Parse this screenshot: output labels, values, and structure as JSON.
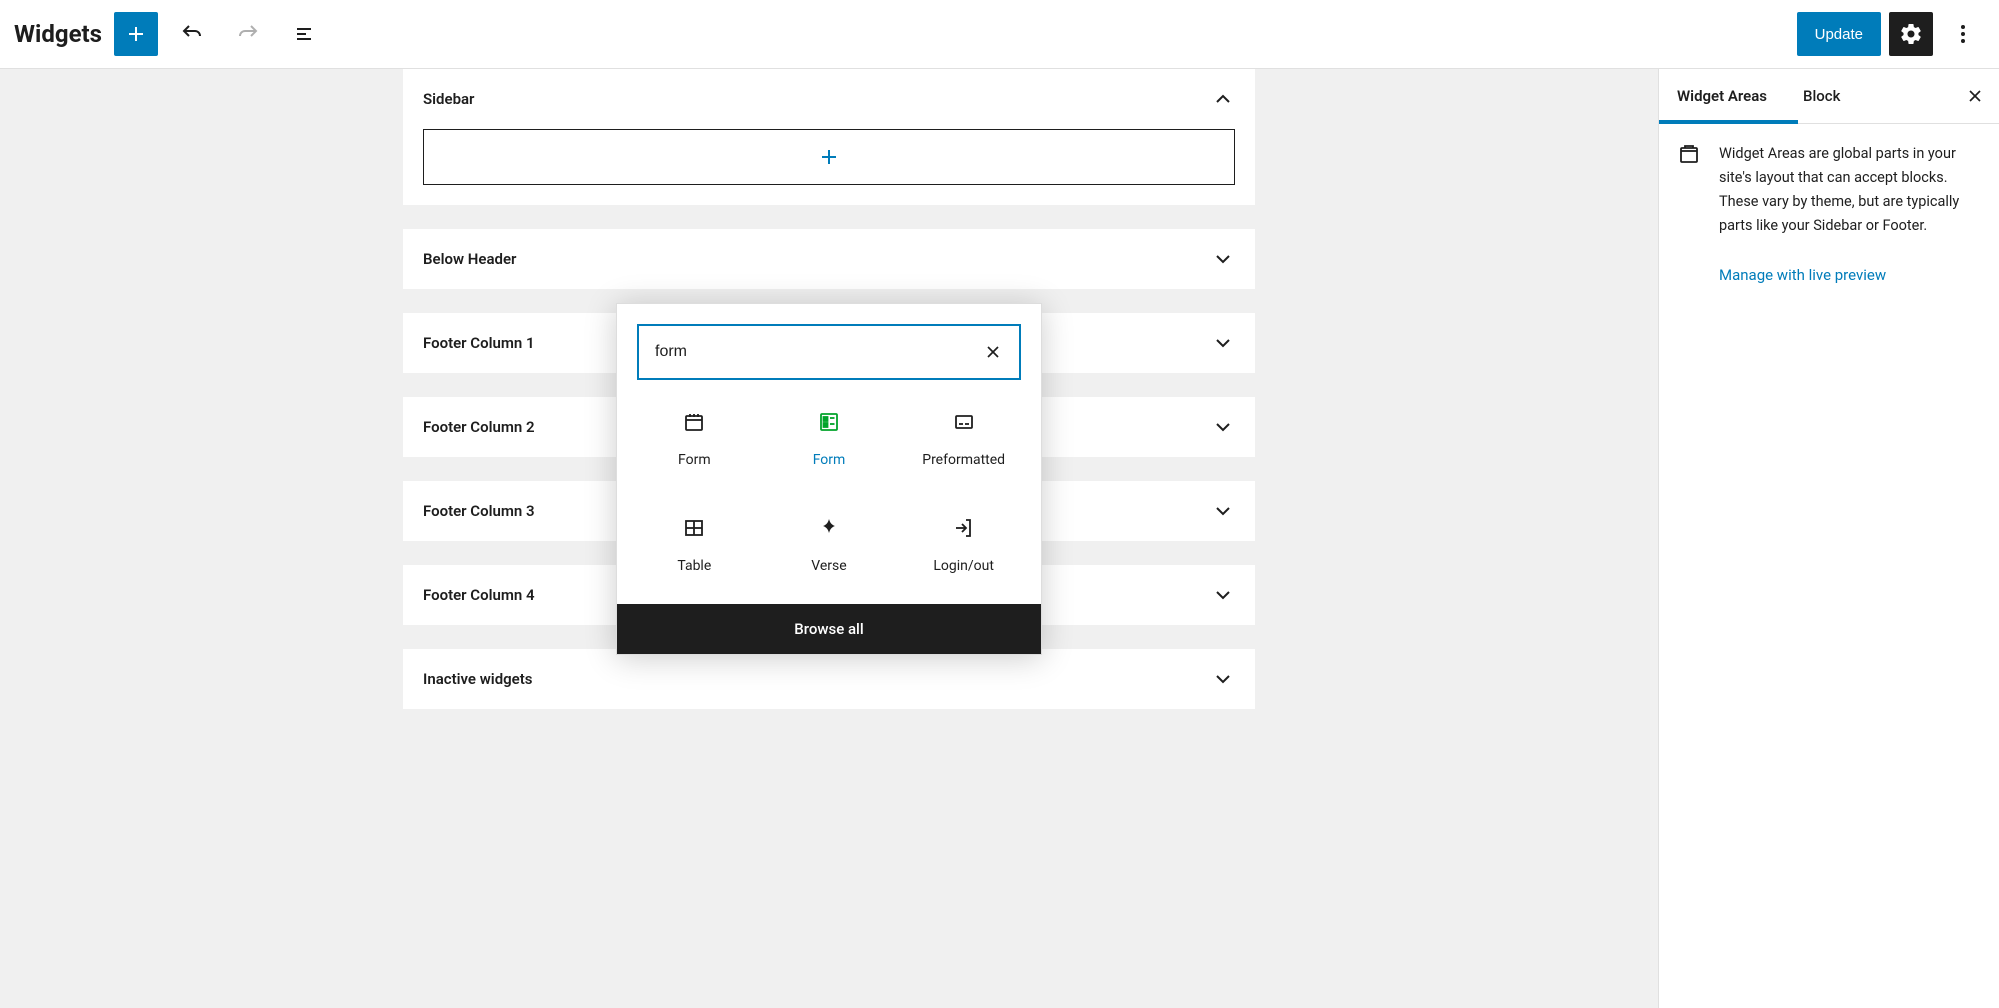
{
  "header": {
    "title": "Widgets",
    "update_label": "Update"
  },
  "areas": [
    {
      "name": "Sidebar",
      "expanded": true
    },
    {
      "name": "Below Header",
      "expanded": false
    },
    {
      "name": "Footer Column 1",
      "expanded": false
    },
    {
      "name": "Footer Column 2",
      "expanded": false
    },
    {
      "name": "Footer Column 3",
      "expanded": false
    },
    {
      "name": "Footer Column 4",
      "expanded": false
    },
    {
      "name": "Inactive widgets",
      "expanded": false
    }
  ],
  "inserter": {
    "search_value": "form",
    "blocks": [
      {
        "name": "Form",
        "icon": "calendar-icon",
        "highlight": false
      },
      {
        "name": "Form",
        "icon": "form-icon",
        "highlight": true
      },
      {
        "name": "Preformatted",
        "icon": "preformatted-icon",
        "highlight": false
      },
      {
        "name": "Table",
        "icon": "table-icon",
        "highlight": false
      },
      {
        "name": "Verse",
        "icon": "verse-icon",
        "highlight": false
      },
      {
        "name": "Login/out",
        "icon": "login-icon",
        "highlight": false
      }
    ],
    "browse_all_label": "Browse all"
  },
  "sidebar": {
    "tabs": {
      "widget_areas": "Widget Areas",
      "block": "Block"
    },
    "active_tab": "widget_areas",
    "description": "Widget Areas are global parts in your site's layout that can accept blocks. These vary by theme, but are typically parts like your Sidebar or Footer.",
    "manage_link": "Manage with live preview"
  }
}
